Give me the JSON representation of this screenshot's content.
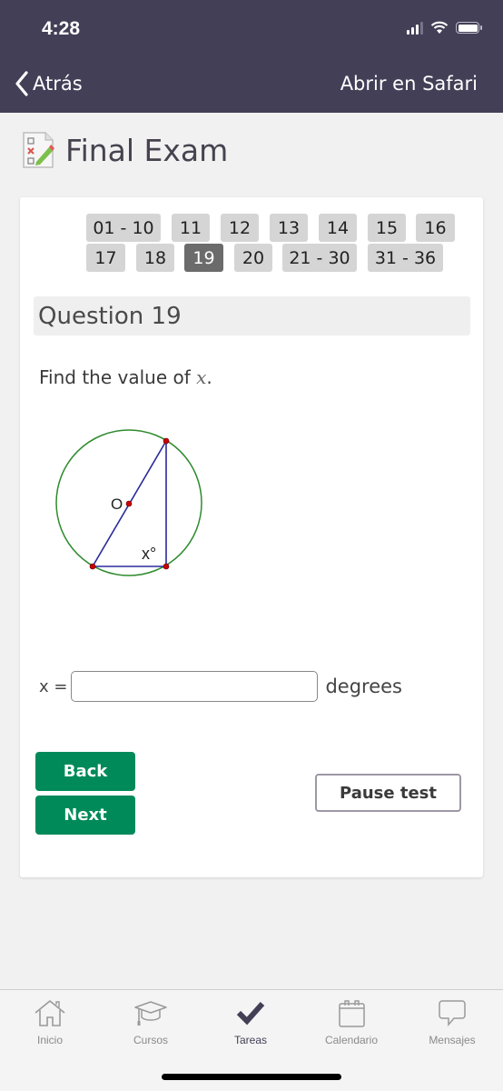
{
  "status_bar": {
    "time": "4:28"
  },
  "nav": {
    "back_label": "Atrás",
    "open_in_safari": "Abrir en Safari"
  },
  "page": {
    "title": "Final Exam",
    "icon": "quiz-checklist-icon"
  },
  "pagination": {
    "row1": [
      "01 - 10",
      "11",
      "12",
      "13",
      "14",
      "15",
      "16"
    ],
    "row2": [
      "17",
      "18",
      "19",
      "20",
      "21 - 30",
      "31 - 36"
    ],
    "current": "19"
  },
  "question": {
    "heading": "Question 19",
    "prompt": "Find the value of ",
    "variable": "x",
    "prompt_end": ".",
    "figure": {
      "center_label": "O",
      "angle_label": "x°",
      "colors": {
        "circle": "#2e8b2e",
        "lines": "#2a2a9a",
        "points": "#cc0000"
      }
    }
  },
  "answer": {
    "label": "x =",
    "value": "",
    "placeholder": "",
    "unit": "degrees"
  },
  "buttons": {
    "back": "Back",
    "next": "Next",
    "pause": "Pause test"
  },
  "tabbar": {
    "items": [
      {
        "label": "Inicio",
        "icon": "home-icon",
        "active": false
      },
      {
        "label": "Cursos",
        "icon": "graduation-cap-icon",
        "active": false
      },
      {
        "label": "Tareas",
        "icon": "checkmark-icon",
        "active": true
      },
      {
        "label": "Calendario",
        "icon": "calendar-icon",
        "active": false
      },
      {
        "label": "Mensajes",
        "icon": "chat-bubble-icon",
        "active": false
      }
    ]
  },
  "colors": {
    "header_bg": "#433f57",
    "accent_green": "#008a5a",
    "active_pill": "#6b6b6b"
  }
}
